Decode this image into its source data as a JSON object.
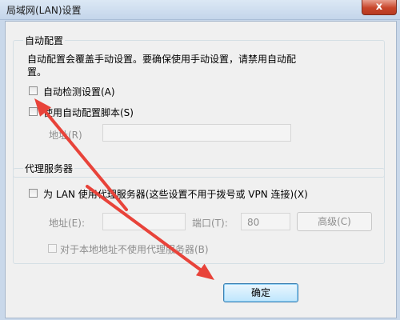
{
  "window": {
    "title": "局域网(LAN)设置",
    "close_label": "x"
  },
  "auto_config": {
    "group_title": "自动配置",
    "description_line1": "自动配置会覆盖手动设置。要确保使用手动设置，请禁用自动配",
    "description_line2": "置。",
    "auto_detect_label": "自动检测设置(A)",
    "script_label": "使用自动配置脚本(S)",
    "address_label": "地址(R)",
    "address_value": ""
  },
  "proxy": {
    "group_title": "代理服务器",
    "use_proxy_label": "为 LAN 使用代理服务器(这些设置不用于拨号或 VPN 连接)(X)",
    "address_label": "地址(E):",
    "address_value": "",
    "port_label": "端口(T):",
    "port_value": "80",
    "advanced_label": "高级(C)",
    "bypass_label": "对于本地地址不使用代理服务器(B)"
  },
  "buttons": {
    "ok_label": "确定"
  },
  "annotations": {
    "arrow_color": "#e8433a"
  }
}
